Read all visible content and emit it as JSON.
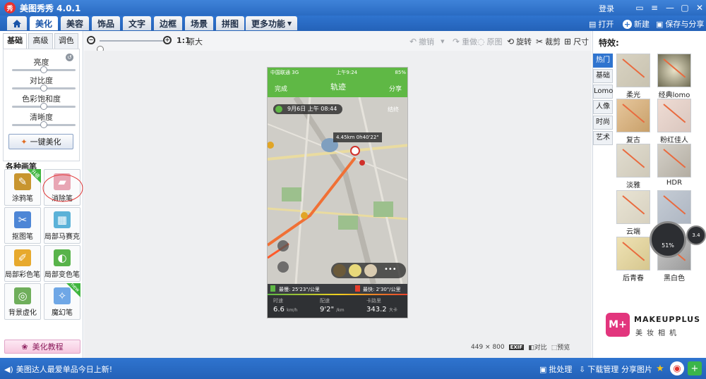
{
  "window": {
    "title": "美图秀秀 4.0.1",
    "login": "登录",
    "logo_text": "秀"
  },
  "menu": {
    "tabs": [
      "美化",
      "美容",
      "饰品",
      "文字",
      "边框",
      "场景",
      "拼图",
      "更多功能"
    ],
    "active": "美化",
    "open": "打开",
    "new": "新建",
    "save_share": "保存与分享"
  },
  "left": {
    "subtabs": [
      "基础",
      "高级",
      "调色"
    ],
    "sliders": [
      {
        "label": "亮度",
        "value": 0.5
      },
      {
        "label": "对比度",
        "value": 0.5
      },
      {
        "label": "色彩饱和度",
        "value": 0.5
      },
      {
        "label": "清晰度",
        "value": 0.5
      }
    ],
    "one_click": "一键美化",
    "pens_heading": "各种画笔",
    "tools": [
      {
        "label": "涂鸦笔",
        "badge": "升级"
      },
      {
        "label": "消除笔",
        "badge": ""
      },
      {
        "label": "抠图笔",
        "badge": ""
      },
      {
        "label": "局部马赛克",
        "badge": ""
      },
      {
        "label": "局部彩色笔",
        "badge": ""
      },
      {
        "label": "局部变色笔",
        "badge": ""
      },
      {
        "label": "背景虚化",
        "badge": ""
      },
      {
        "label": "魔幻笔",
        "badge": "new"
      }
    ],
    "tutorial": "美化教程"
  },
  "toolbar": {
    "zoom_value": 0,
    "ratio": "1:1",
    "original": "原大",
    "undo": "撤销",
    "redo": "重做",
    "original_img": "原图",
    "rotate": "旋转",
    "crop": "裁剪",
    "size": "尺寸"
  },
  "photo": {
    "carrier": "中国联通",
    "network": "3G",
    "time": "上午9:24",
    "battery": "85%",
    "done": "完成",
    "title": "轨迹",
    "share": "分享",
    "date_chip": "9月6日 上午 08:44",
    "end_label": "结终",
    "tooltip": "4.45km 0h40'22\"",
    "slowest": "最慢: 25'23\"/公里",
    "fastest": "最快: 2'30\"/公里",
    "stats": [
      {
        "label": "时速",
        "value": "6.6",
        "unit": "km/h"
      },
      {
        "label": "配速",
        "value": "9'2\"",
        "unit": "/km"
      },
      {
        "label": "卡路里",
        "value": "343.2",
        "unit": "大卡"
      }
    ]
  },
  "canvas_info": {
    "dimensions": "449 × 800",
    "exif": "EXIF",
    "compare": "对比",
    "preview": "预览"
  },
  "right": {
    "heading": "特效:",
    "categories": [
      "热门",
      "基础",
      "Lomo",
      "人像",
      "时尚",
      "艺术"
    ],
    "active": "热门",
    "effects": [
      "柔光",
      "经典lomo",
      "复古",
      "粉红佳人",
      "淡雅",
      "HDR",
      "云端",
      "",
      "后青春",
      "黑白色"
    ],
    "gauge_percent": "51%",
    "gauge_small": "3.4",
    "brand_title": "MAKEUPPLUS",
    "brand_sub": "美妆相机"
  },
  "statusbar": {
    "message": "美图达人最爱单品今日上新!",
    "batch": "批处理",
    "download": "下载管理",
    "share_pic": "分享图片"
  },
  "colors": {
    "accent": "#2f74cf",
    "green": "#5fb845",
    "track": "#e96a3e"
  }
}
